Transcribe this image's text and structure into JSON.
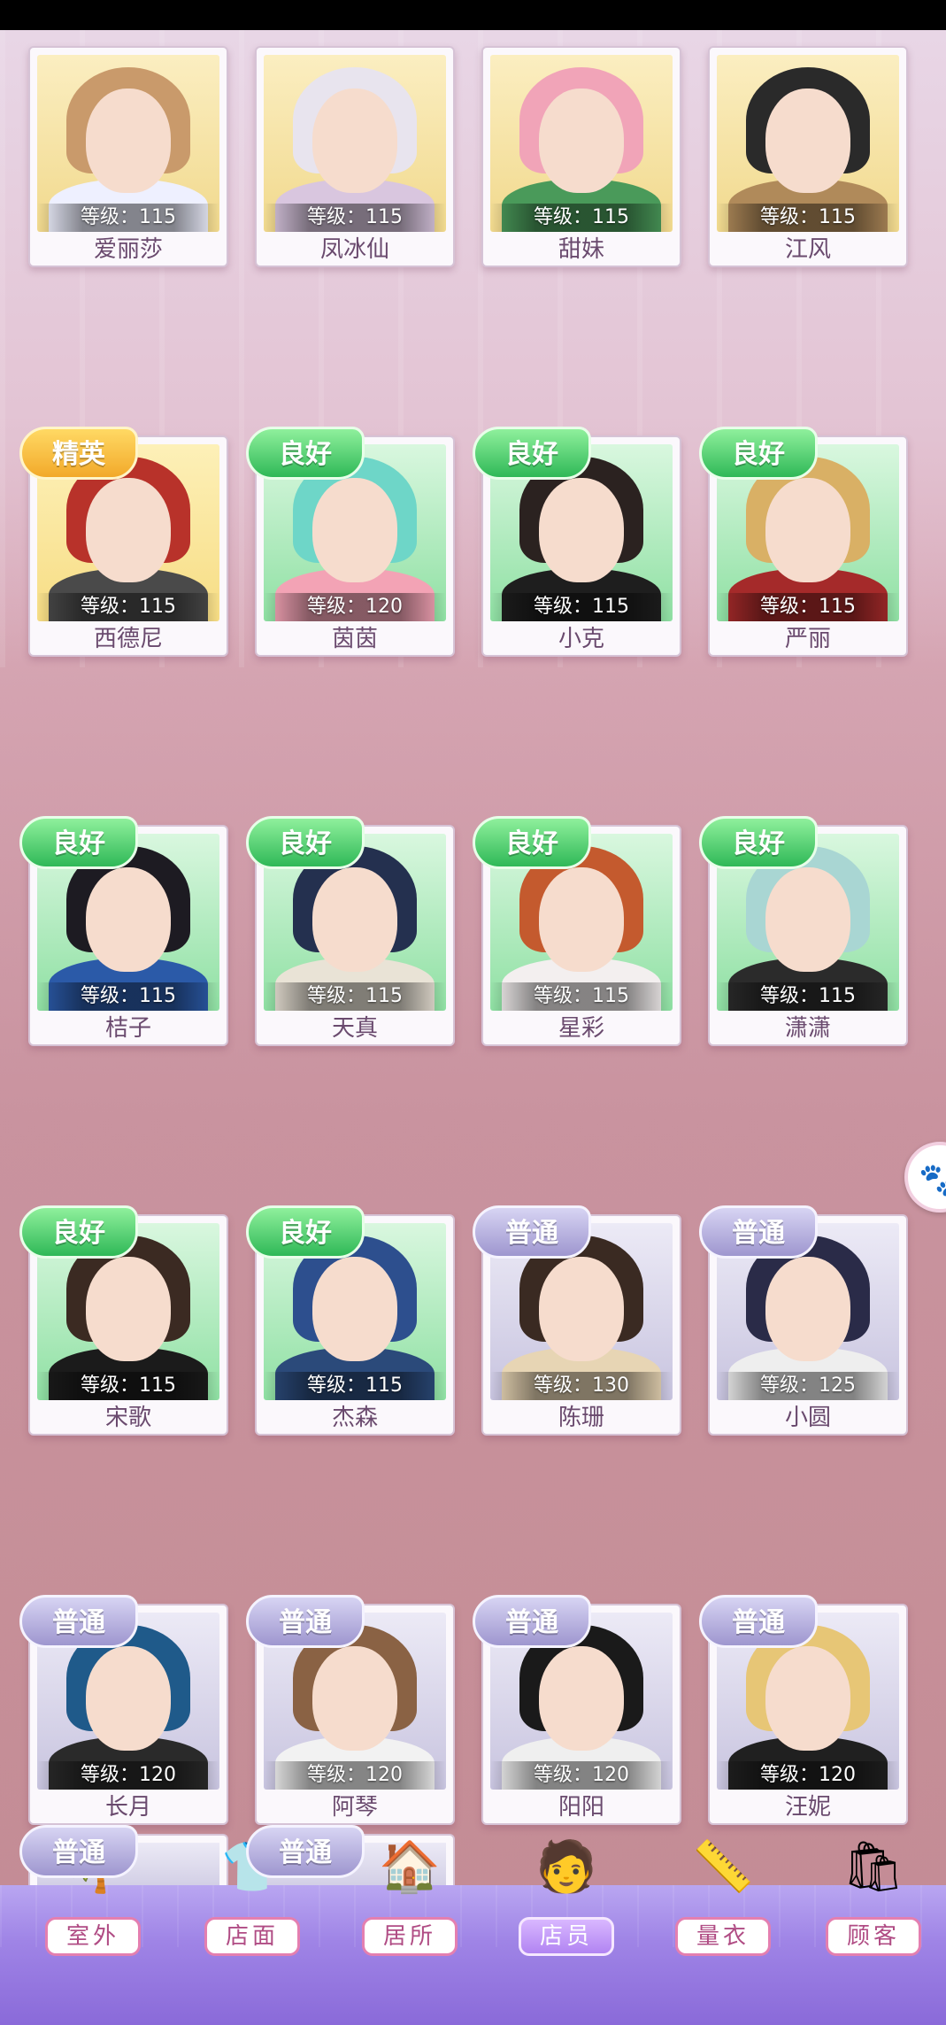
{
  "rows": [
    [
      {
        "name": "爱丽莎",
        "level": "等级：115",
        "badge": "",
        "tier": "top",
        "hair": "#c99a6b",
        "body": "#eef0ff"
      },
      {
        "name": "凤冰仙",
        "level": "等级：115",
        "badge": "",
        "tier": "top",
        "hair": "#e8e4ee",
        "body": "#d9c6df"
      },
      {
        "name": "甜妹",
        "level": "等级：115",
        "badge": "",
        "tier": "top",
        "hair": "#f1a4b8",
        "body": "#4a9a5a"
      },
      {
        "name": "江风",
        "level": "等级：115",
        "badge": "",
        "tier": "top",
        "hair": "#2a2a2a",
        "body": "#b08a5a"
      }
    ],
    [
      {
        "name": "西德尼",
        "level": "等级：115",
        "badge": "精英",
        "tier": "elite",
        "hair": "#b8322a",
        "body": "#4a4a4a"
      },
      {
        "name": "茵茵",
        "level": "等级：120",
        "badge": "良好",
        "tier": "good",
        "hair": "#6ed6c8",
        "body": "#f3a3b5"
      },
      {
        "name": "小克",
        "level": "等级：115",
        "badge": "良好",
        "tier": "good",
        "hair": "#2b2220",
        "body": "#1e1e1e"
      },
      {
        "name": "严丽",
        "level": "等级：115",
        "badge": "良好",
        "tier": "good",
        "hair": "#d9b065",
        "body": "#a52a2a"
      }
    ],
    [
      {
        "name": "桔子",
        "level": "等级：115",
        "badge": "良好",
        "tier": "good",
        "hair": "#1d1b22",
        "body": "#2b5aa8"
      },
      {
        "name": "天真",
        "level": "等级：115",
        "badge": "良好",
        "tier": "good",
        "hair": "#24304f",
        "body": "#e9e3d6"
      },
      {
        "name": "星彩",
        "level": "等级：115",
        "badge": "良好",
        "tier": "good",
        "hair": "#c45a2e",
        "body": "#f3efef"
      },
      {
        "name": "潇潇",
        "level": "等级：115",
        "badge": "良好",
        "tier": "good",
        "hair": "#a9d6d3",
        "body": "#2b2b2b"
      }
    ],
    [
      {
        "name": "宋歌",
        "level": "等级：115",
        "badge": "良好",
        "tier": "good",
        "hair": "#3b2a22",
        "body": "#1b1b1b"
      },
      {
        "name": "杰森",
        "level": "等级：115",
        "badge": "良好",
        "tier": "good",
        "hair": "#2d4f8e",
        "body": "#2b4a7a"
      },
      {
        "name": "陈珊",
        "level": "等级：130",
        "badge": "普通",
        "tier": "normal",
        "hair": "#3a2a22",
        "body": "#e7d5b4"
      },
      {
        "name": "小圆",
        "level": "等级：125",
        "badge": "普通",
        "tier": "normal",
        "hair": "#2a2b48",
        "body": "#eee"
      }
    ],
    [
      {
        "name": "长月",
        "level": "等级：120",
        "badge": "普通",
        "tier": "normal",
        "hair": "#1f5a8a",
        "body": "#2a2a2a"
      },
      {
        "name": "阿琴",
        "level": "等级：120",
        "badge": "普通",
        "tier": "normal",
        "hair": "#8a6244",
        "body": "#f2f2f2"
      },
      {
        "name": "阳阳",
        "level": "等级：120",
        "badge": "普通",
        "tier": "normal",
        "hair": "#1a1a1a",
        "body": "#efefef"
      },
      {
        "name": "汪妮",
        "level": "等级：120",
        "badge": "普通",
        "tier": "normal",
        "hair": "#e7c676",
        "body": "#202020"
      }
    ]
  ],
  "partial_row_badge": "普通",
  "nav": [
    {
      "label": "室外",
      "icon": "palm-tree-icon",
      "glyph": "🌴",
      "active": false
    },
    {
      "label": "店面",
      "icon": "shop-icon",
      "glyph": "👕",
      "active": false
    },
    {
      "label": "居所",
      "icon": "house-icon",
      "glyph": "🏠",
      "active": false
    },
    {
      "label": "店员",
      "icon": "staff-avatar-icon",
      "glyph": "🧑",
      "active": true
    },
    {
      "label": "量衣",
      "icon": "tape-measure-icon",
      "glyph": "📏",
      "active": false
    },
    {
      "label": "顾客",
      "icon": "shopping-bag-icon",
      "glyph": "🛍",
      "active": false
    }
  ],
  "side_button": {
    "icon": "paw-icon",
    "glyph": "🐾"
  },
  "colors": {
    "elite": "#f2a92a",
    "good": "#2fb857",
    "normal": "#9e96cf",
    "active_nav": "#b184f2"
  }
}
